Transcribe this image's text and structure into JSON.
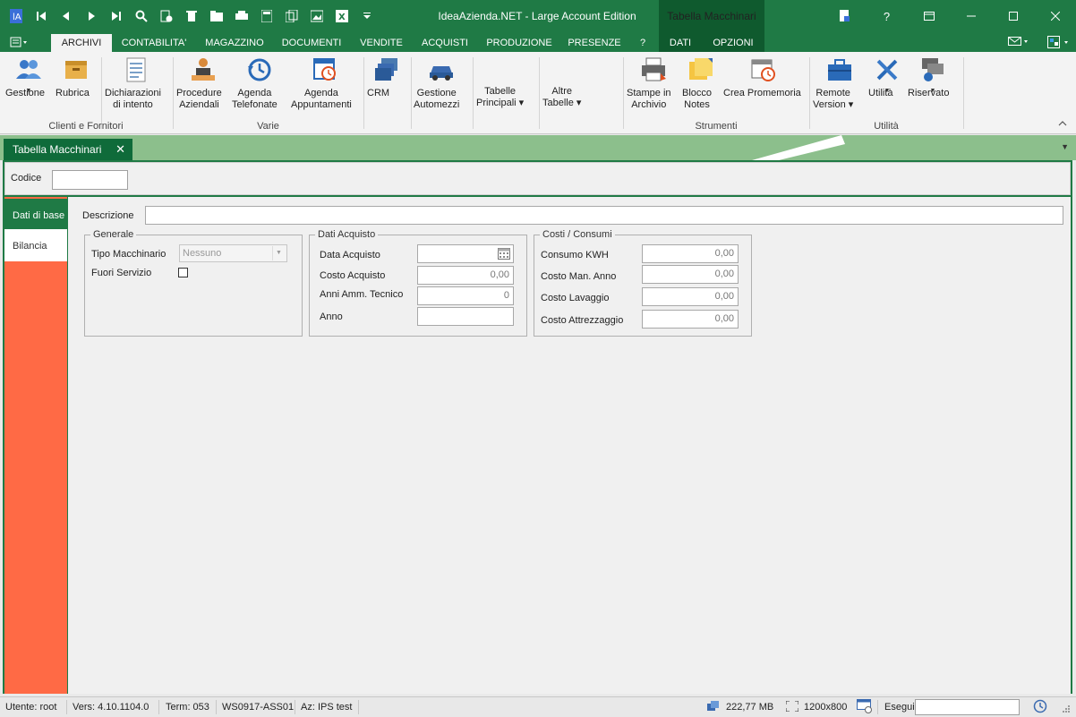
{
  "titlebar": {
    "app_title": "IdeaAzienda.NET - Large Account Edition",
    "context_title": "Tabella Macchinari",
    "qat_icons": [
      "app-logo-icon",
      "first-record-icon",
      "prev-record-icon",
      "next-record-icon",
      "last-record-icon",
      "search-icon",
      "new-record-icon",
      "delete-icon",
      "open-folder-icon",
      "print-icon",
      "calculator-icon",
      "copy-icon",
      "image-icon",
      "excel-icon",
      "customize-icon"
    ],
    "window_controls": [
      "document-icon",
      "help-icon",
      "ribbon-options-icon",
      "minimize-icon",
      "maximize-icon",
      "close-icon"
    ]
  },
  "ribbon_tabs": {
    "file_tab": "☰",
    "tabs": [
      "ARCHIVI",
      "CONTABILITA'",
      "MAGAZZINO",
      "DOCUMENTI",
      "VENDITE",
      "ACQUISTI",
      "PRODUZIONE",
      "PRESENZE",
      "?"
    ],
    "context_tabs": [
      "DATI",
      "OPZIONI"
    ],
    "active_tab": "ARCHIVI"
  },
  "ribbon": {
    "buttons": [
      {
        "label": "Gestione",
        "caret": true
      },
      {
        "label": "Rubrica",
        "caret": false
      },
      {
        "label": "Dichiarazioni\ndi intento",
        "caret": false
      },
      {
        "label": "Procedure\nAziendali",
        "caret": false
      },
      {
        "label": "Agenda\nTelefonate",
        "caret": false
      },
      {
        "label": "Agenda\nAppuntamenti",
        "caret": false
      },
      {
        "label": "CRM",
        "caret": false
      },
      {
        "label": "Gestione\nAutomezzi",
        "caret": false
      },
      {
        "label": "Tabelle\nPrincipali ▾",
        "caret": false
      },
      {
        "label": "Altre\nTabelle ▾",
        "caret": false
      },
      {
        "label": "Stampe in\nArchivio",
        "caret": false
      },
      {
        "label": "Blocco\nNotes",
        "caret": false
      },
      {
        "label": "Crea Promemoria",
        "caret": false
      },
      {
        "label": "Remote\nVersion ▾",
        "caret": false
      },
      {
        "label": "Utilità",
        "caret": true
      },
      {
        "label": "Riservato",
        "caret": true
      }
    ],
    "groups": [
      "Clienti e Fornitori",
      "Varie",
      "Strumenti",
      "Utilità"
    ]
  },
  "doc_tab": {
    "label": "Tabella Macchinari",
    "close": "✕"
  },
  "form": {
    "codice_label": "Codice",
    "codice_value": "",
    "descrizione_label": "Descrizione",
    "descrizione_value": "",
    "side_tabs": [
      "Dati di base",
      "Bilancia"
    ],
    "active_side_tab": "Dati di base",
    "generale": {
      "title": "Generale",
      "tipo_label": "Tipo Macchinario",
      "tipo_value": "Nessuno",
      "fuori_label": "Fuori Servizio",
      "fuori_checked": false
    },
    "acquisto": {
      "title": "Dati Acquisto",
      "data_label": "Data Acquisto",
      "data_value": "",
      "costo_label": "Costo Acquisto",
      "costo_value": "0,00",
      "anni_label": "Anni Amm. Tecnico",
      "anni_value": "0",
      "anno_label": "Anno",
      "anno_value": ""
    },
    "costi": {
      "title": "Costi / Consumi",
      "kwh_label": "Consumo KWH",
      "kwh_value": "0,00",
      "man_label": "Costo Man. Anno",
      "man_value": "0,00",
      "lav_label": "Costo Lavaggio",
      "lav_value": "0,00",
      "attr_label": "Costo Attrezzaggio",
      "attr_value": "0,00"
    }
  },
  "status": {
    "utente": "Utente: root",
    "versione": "Vers: 4.10.1104.0",
    "term": "Term: 053",
    "workstation": "WS0917-ASS01",
    "azienda": "Az: IPS test",
    "memory": "222,77 MB",
    "resolution": "1200x800",
    "esegui_label": "Esegui",
    "esegui_value": ""
  },
  "colors": {
    "brand_green": "#1f7a45",
    "dark_green": "#0f5a2e",
    "strip_green": "#8cbf8c",
    "sidebar_orange": "#ff6a45"
  }
}
